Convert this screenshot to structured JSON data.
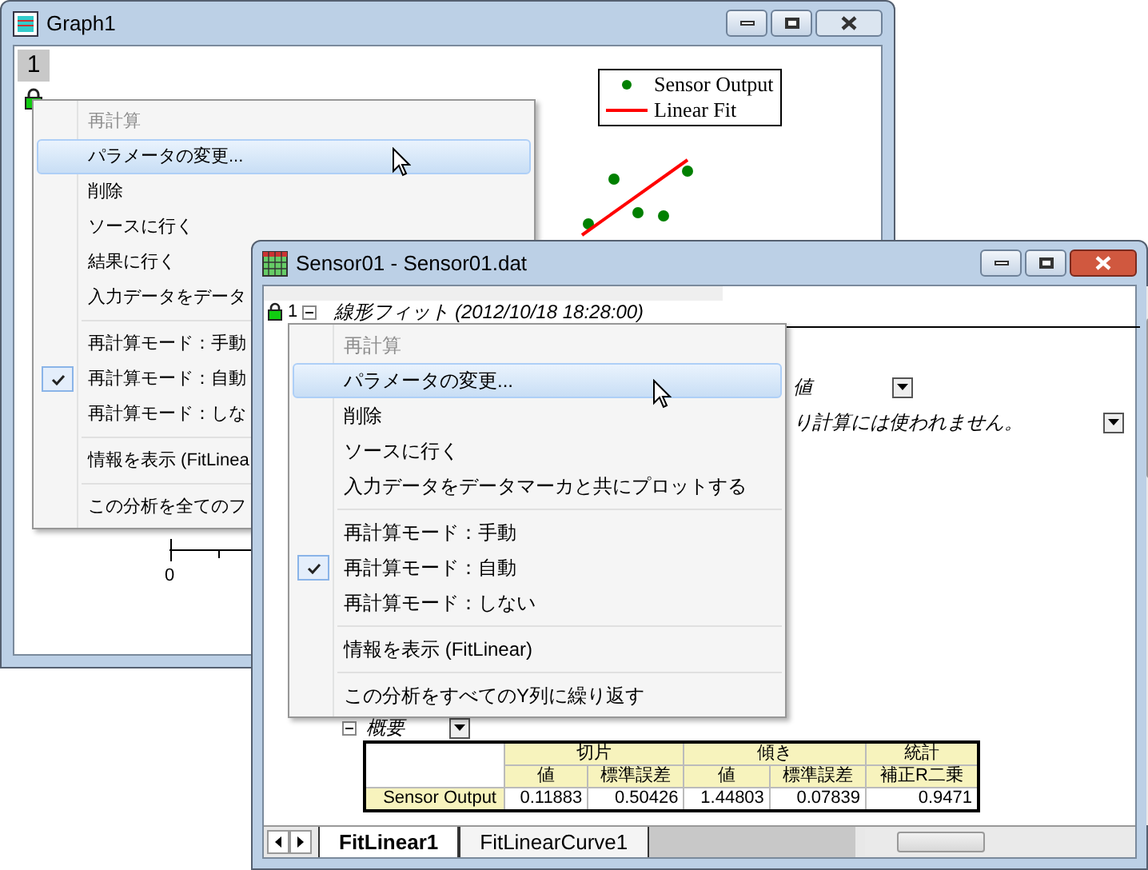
{
  "graph_window": {
    "title": "Graph1",
    "active": false,
    "layer": "1",
    "legend": [
      {
        "kind": "marker",
        "label": "Sensor Output",
        "color": "#008000"
      },
      {
        "kind": "line",
        "label": "Linear Fit",
        "color": "#ff0000"
      }
    ],
    "x_tick": "0",
    "menu": [
      {
        "kind": "item",
        "label": "再計算",
        "disabled": true,
        "checked": false,
        "selected": false
      },
      {
        "kind": "item",
        "label": "パラメータの変更...",
        "disabled": false,
        "checked": false,
        "selected": true
      },
      {
        "kind": "item",
        "label": "削除",
        "disabled": false,
        "checked": false,
        "selected": false
      },
      {
        "kind": "item",
        "label": "ソースに行く",
        "disabled": false,
        "checked": false,
        "selected": false
      },
      {
        "kind": "item",
        "label": "結果に行く",
        "disabled": false,
        "checked": false,
        "selected": false
      },
      {
        "kind": "item",
        "label": "入力データをデータ",
        "disabled": false,
        "checked": false,
        "selected": false
      },
      {
        "kind": "separator"
      },
      {
        "kind": "item",
        "label": "再計算モード：手動",
        "disabled": false,
        "checked": false,
        "selected": false
      },
      {
        "kind": "item",
        "label": "再計算モード：自動",
        "disabled": false,
        "checked": true,
        "selected": false
      },
      {
        "kind": "item",
        "label": "再計算モード：しな",
        "disabled": false,
        "checked": false,
        "selected": false
      },
      {
        "kind": "separator"
      },
      {
        "kind": "item",
        "label": "情報を表示 (FitLinea",
        "disabled": false,
        "checked": false,
        "selected": false
      },
      {
        "kind": "separator"
      },
      {
        "kind": "item",
        "label": "この分析を全てのフ",
        "disabled": false,
        "checked": false,
        "selected": false
      }
    ]
  },
  "report_window": {
    "title": "Sensor01 - Sensor01.dat",
    "active": true,
    "heading_number": "1",
    "heading": "線形フィット (2012/10/18 18:28:00)",
    "notes": [
      {
        "text": "値"
      },
      {
        "text": "り計算には使われません。"
      }
    ],
    "section": "概要",
    "table": {
      "groups": [
        {
          "label": "切片",
          "columns": [
            "値",
            "標準誤差"
          ]
        },
        {
          "label": "傾き",
          "columns": [
            "値",
            "標準誤差"
          ]
        },
        {
          "label": "統計",
          "columns": [
            "補正R二乗"
          ]
        }
      ],
      "rows": [
        {
          "label": "Sensor Output",
          "cells": [
            "0.11883",
            "0.50426",
            "1.44803",
            "0.07839",
            "0.9471"
          ]
        }
      ]
    },
    "tabs": [
      {
        "label": "FitLinear1",
        "selected": true
      },
      {
        "label": "FitLinearCurve1",
        "selected": false
      }
    ],
    "menu": [
      {
        "kind": "item",
        "label": "再計算",
        "disabled": true,
        "checked": false,
        "selected": false
      },
      {
        "kind": "item",
        "label": "パラメータの変更...",
        "disabled": false,
        "checked": false,
        "selected": true
      },
      {
        "kind": "item",
        "label": "削除",
        "disabled": false,
        "checked": false,
        "selected": false
      },
      {
        "kind": "item",
        "label": "ソースに行く",
        "disabled": false,
        "checked": false,
        "selected": false
      },
      {
        "kind": "item",
        "label": "入力データをデータマーカと共にプロットする",
        "disabled": false,
        "checked": false,
        "selected": false
      },
      {
        "kind": "separator"
      },
      {
        "kind": "item",
        "label": "再計算モード：手動",
        "disabled": false,
        "checked": false,
        "selected": false
      },
      {
        "kind": "item",
        "label": "再計算モード：自動",
        "disabled": false,
        "checked": true,
        "selected": false
      },
      {
        "kind": "item",
        "label": "再計算モード：しない",
        "disabled": false,
        "checked": false,
        "selected": false
      },
      {
        "kind": "separator"
      },
      {
        "kind": "item",
        "label": "情報を表示 (FitLinear)",
        "disabled": false,
        "checked": false,
        "selected": false
      },
      {
        "kind": "separator"
      },
      {
        "kind": "item",
        "label": "この分析をすべてのY列に繰り返す",
        "disabled": false,
        "checked": false,
        "selected": false
      }
    ]
  }
}
